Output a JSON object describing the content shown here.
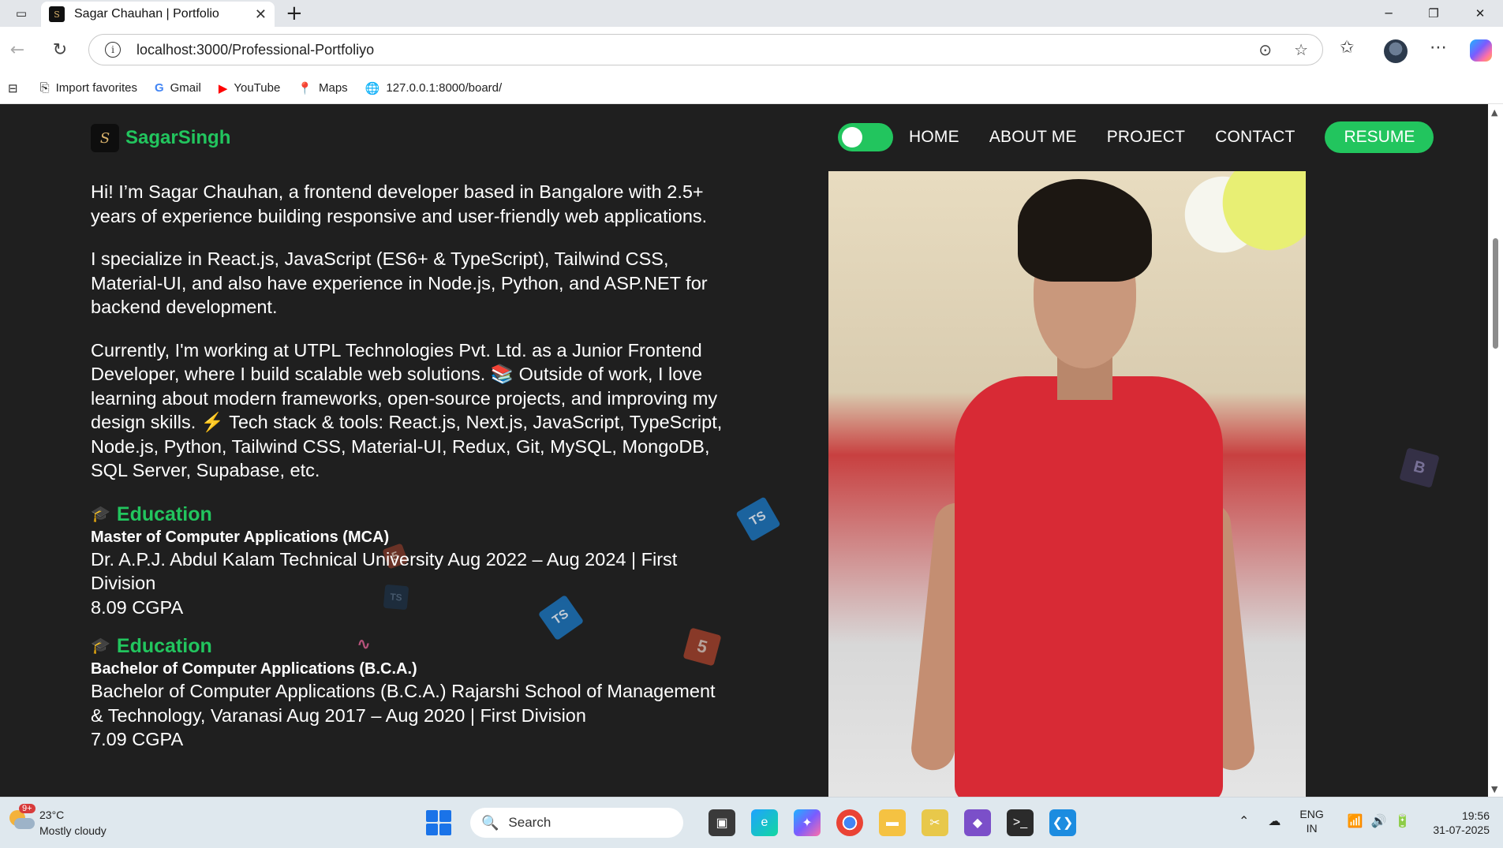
{
  "browser": {
    "tab_title": "Sagar Chauhan | Portfolio",
    "url": "localhost:3000/Professional-Portfoliyo",
    "favorites": [
      "Import favorites",
      "Gmail",
      "YouTube",
      "Maps",
      "127.0.0.1:8000/board/"
    ]
  },
  "site": {
    "logo_text": "SagarSingh",
    "nav": [
      "HOME",
      "ABOUT ME",
      "PROJECT",
      "CONTACT"
    ],
    "resume_label": "RESUME",
    "accent_color": "#22c55e",
    "theme_toggle_on": true
  },
  "about": {
    "paragraphs": [
      "Hi! I’m Sagar Chauhan, a frontend developer based in Bangalore with 2.5+ years of experience building responsive and user-friendly web applications.",
      "I specialize in React.js, JavaScript (ES6+ & TypeScript), Tailwind CSS, Material-UI, and also have experience in Node.js, Python, and ASP.NET for backend development.",
      "Currently, I'm working at UTPL Technologies Pvt. Ltd. as a Junior Frontend Developer, where I build scalable web solutions. 📚 Outside of work, I love learning about modern frameworks, open-source projects, and improving my design skills. ⚡ Tech stack & tools: React.js, Next.js, JavaScript, TypeScript, Node.js, Python, Tailwind CSS, Material-UI, Redux, Git, MySQL, MongoDB, SQL Server, Supabase, etc."
    ],
    "education": [
      {
        "heading": "Education",
        "degree": "Master of Computer Applications (MCA)",
        "detail": "Dr. A.P.J. Abdul Kalam Technical University Aug 2022 – Aug 2024 | First Division",
        "grade": "8.09 CGPA"
      },
      {
        "heading": "Education",
        "degree": "Bachelor of Computer Applications (B.C.A.)",
        "detail": "Bachelor of Computer Applications (B.C.A.) Rajarshi School of Management & Technology, Varanasi Aug 2017 – Aug 2020 | First Division",
        "grade": "7.09 CGPA"
      }
    ]
  },
  "taskbar": {
    "weather_temp": "23°C",
    "weather_desc": "Mostly cloudy",
    "weather_badge": "9+",
    "search_placeholder": "Search",
    "lang_line1": "ENG",
    "lang_line2": "IN",
    "time": "19:56",
    "date": "31-07-2025"
  },
  "icons": {
    "tab_favicon": "S",
    "floating": [
      "TS",
      "TS",
      "TS",
      "5",
      "5",
      "B"
    ]
  }
}
